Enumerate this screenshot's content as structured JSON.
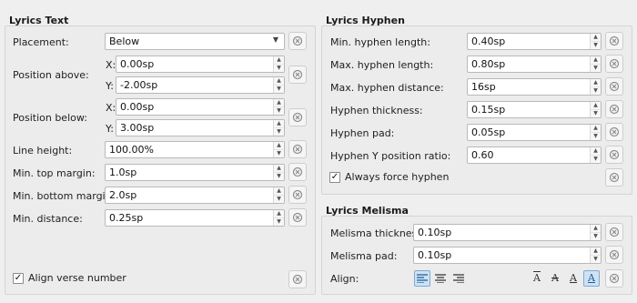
{
  "lyrics_text": {
    "title": "Lyrics Text",
    "placement": {
      "label": "Placement:",
      "value": "Below"
    },
    "position_above": {
      "label": "Position above:",
      "x_label": "X:",
      "x_value": "0.00sp",
      "y_label": "Y:",
      "y_value": "-2.00sp"
    },
    "position_below": {
      "label": "Position below:",
      "x_label": "X:",
      "x_value": "0.00sp",
      "y_label": "Y:",
      "y_value": "3.00sp"
    },
    "line_height": {
      "label": "Line height:",
      "value": "100.00%"
    },
    "min_top_margin": {
      "label": "Min. top margin:",
      "value": "1.0sp"
    },
    "min_bottom_margin": {
      "label": "Min. bottom margin:",
      "value": "2.0sp"
    },
    "min_distance": {
      "label": "Min. distance:",
      "value": "0.25sp"
    },
    "align_verse_number": {
      "label": "Align verse number",
      "checked": true,
      "mark": "✓"
    }
  },
  "lyrics_hyphen": {
    "title": "Lyrics Hyphen",
    "min_hyphen_length": {
      "label": "Min. hyphen length:",
      "value": "0.40sp"
    },
    "max_hyphen_length": {
      "label": "Max. hyphen length:",
      "value": "0.80sp"
    },
    "max_hyphen_distance": {
      "label": "Max. hyphen distance:",
      "value": "16sp"
    },
    "hyphen_thickness": {
      "label": "Hyphen thickness:",
      "value": "0.15sp"
    },
    "hyphen_pad": {
      "label": "Hyphen pad:",
      "value": "0.05sp"
    },
    "hyphen_y_ratio": {
      "label": "Hyphen Y position ratio:",
      "value": "0.60"
    },
    "always_force_hyphen": {
      "label": "Always force hyphen",
      "checked": true,
      "mark": "✓"
    }
  },
  "lyrics_melisma": {
    "title": "Lyrics Melisma",
    "melisma_thickness": {
      "label": "Melisma thickness:",
      "value": "0.10sp"
    },
    "melisma_pad": {
      "label": "Melisma pad:",
      "value": "0.10sp"
    },
    "align": {
      "label": "Align:",
      "selected_horizontal": "left",
      "selected_vertical": "baseline"
    }
  },
  "icons": {
    "spin_up": "▲",
    "spin_down": "▼",
    "dropdown": "▼",
    "align_left": "≡",
    "align_center": "≡",
    "align_right": "≡",
    "valign_glyph": "A"
  },
  "colors": {
    "background": "#efefef",
    "active_button": "#cde2f4"
  }
}
